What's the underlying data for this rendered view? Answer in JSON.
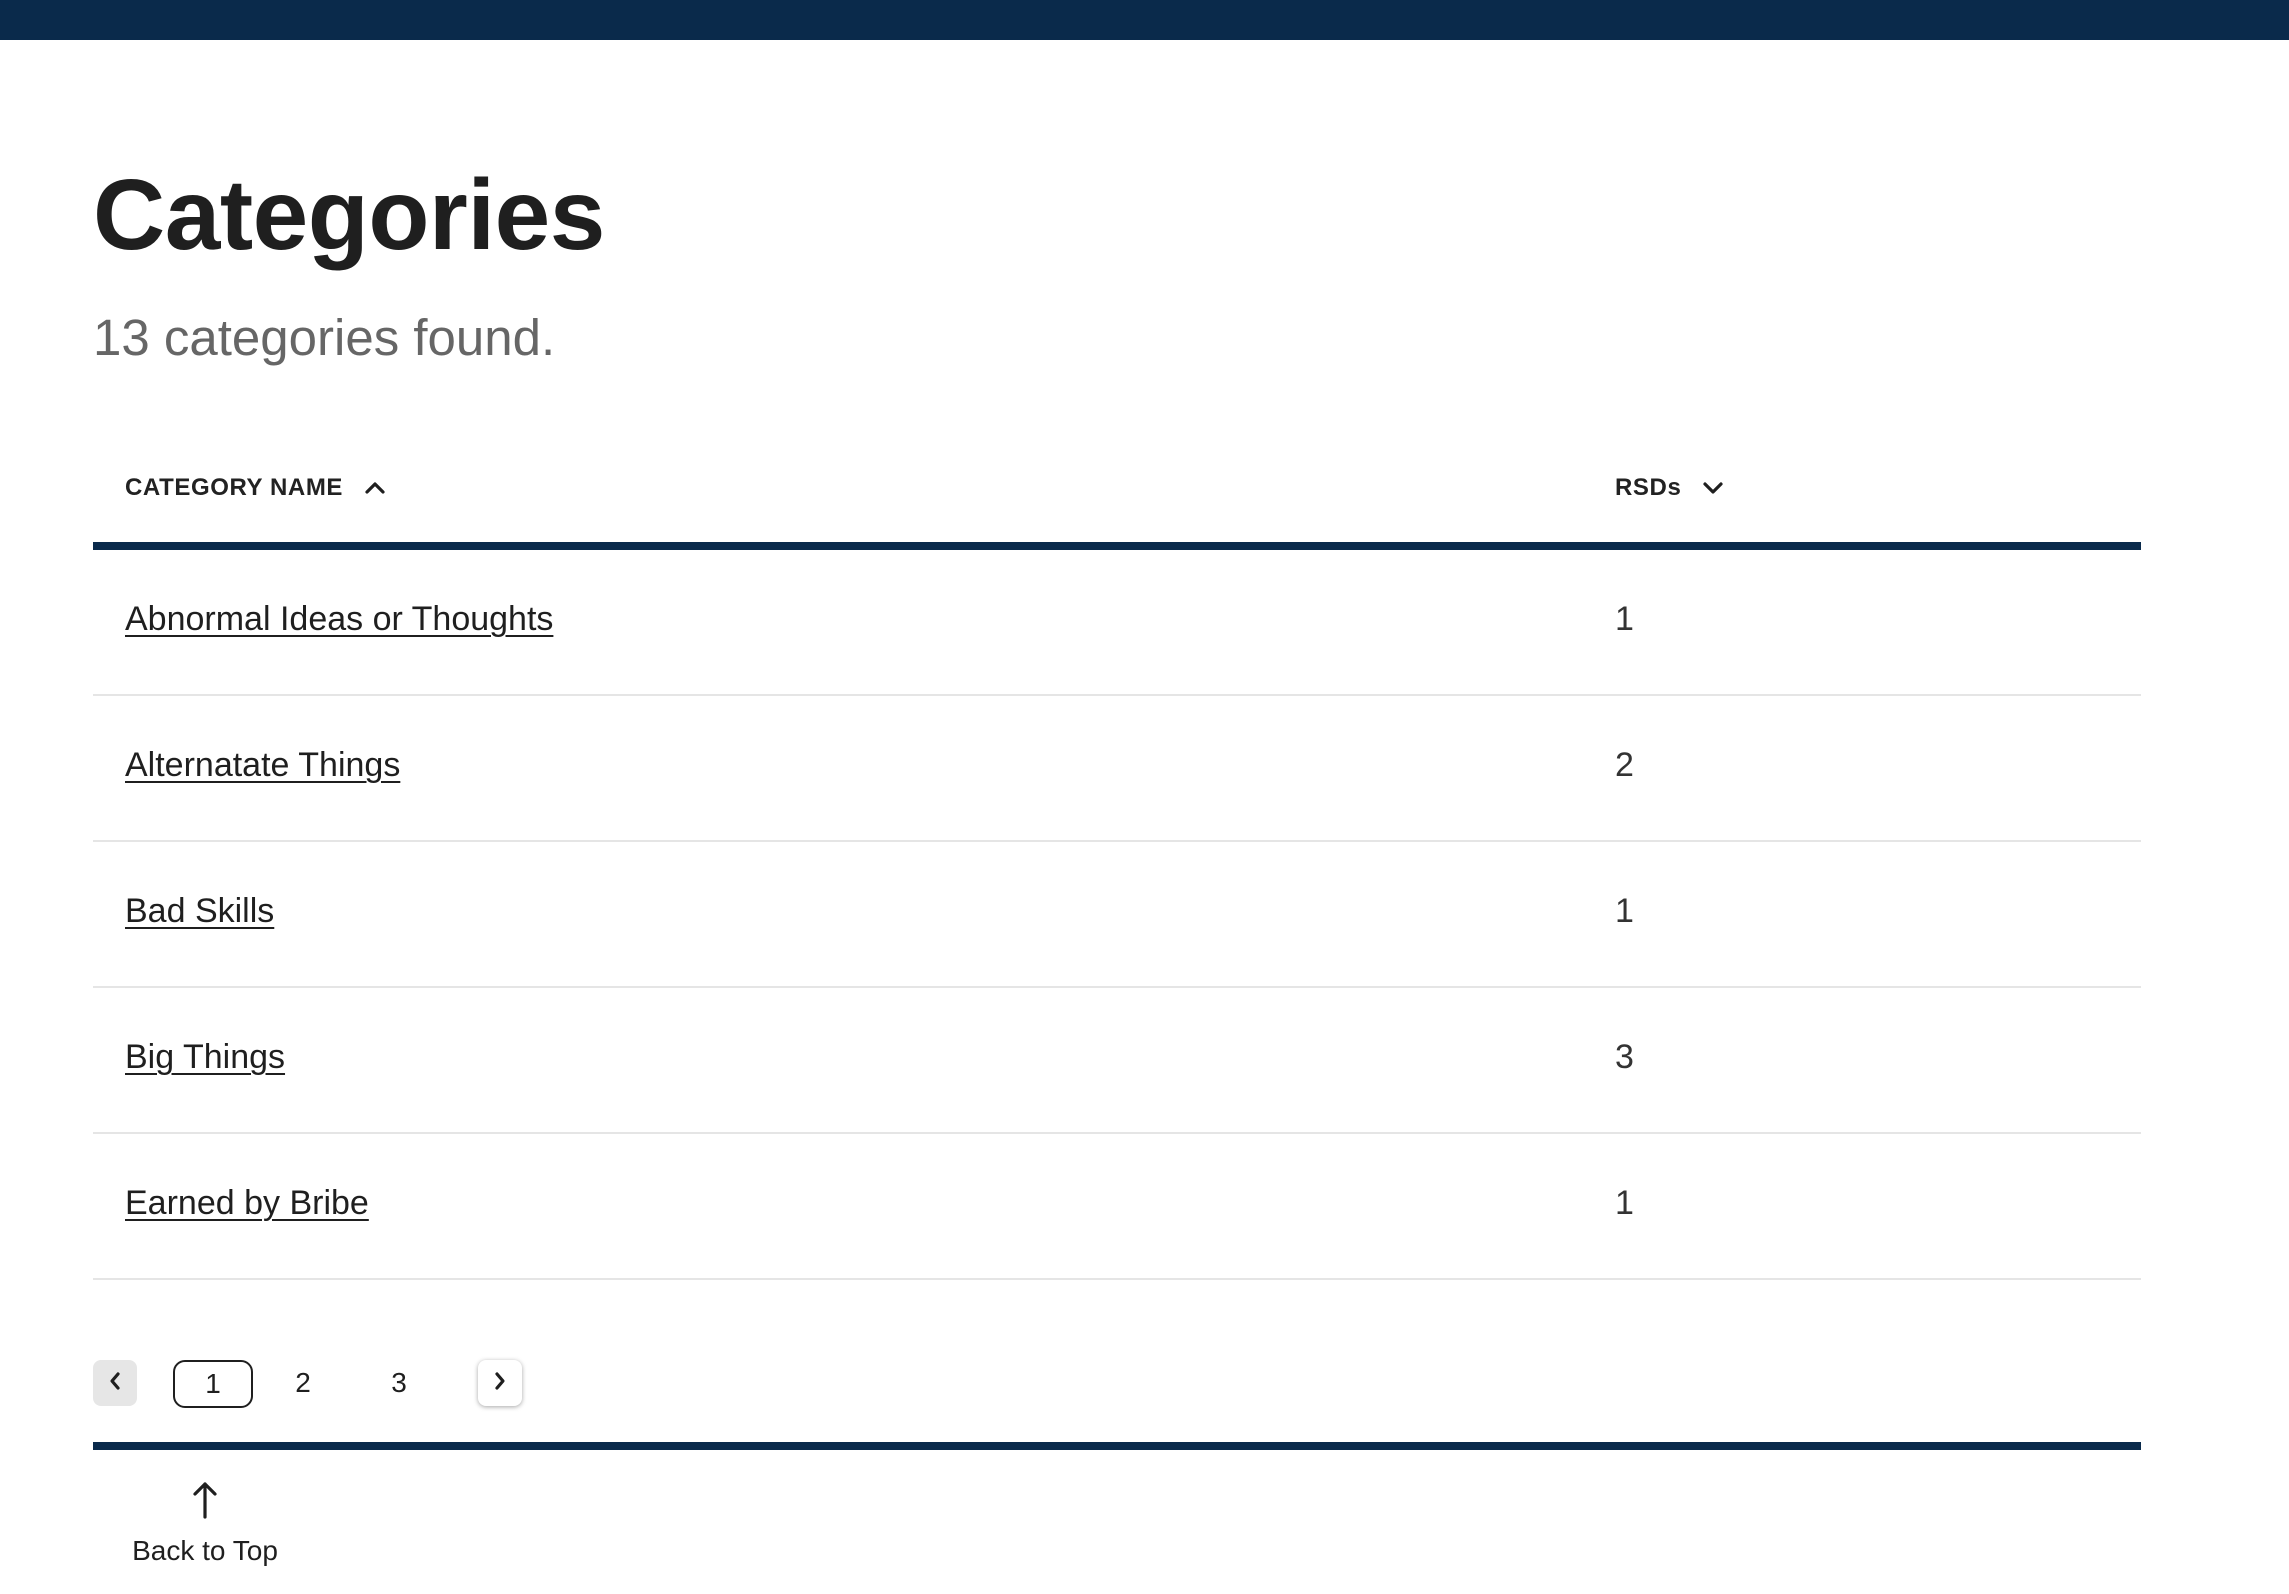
{
  "page": {
    "title": "Categories",
    "result_summary": "13 categories found."
  },
  "table": {
    "columns": [
      {
        "label": "CATEGORY NAME",
        "sort": "ascending",
        "icon": "chevron-up-icon"
      },
      {
        "label": "RSDs",
        "sort": "descending",
        "icon": "chevron-down-icon"
      }
    ],
    "rows": [
      {
        "name": "Abnormal Ideas or Thoughts",
        "rsds": "1"
      },
      {
        "name": "Alternatate Things",
        "rsds": "2"
      },
      {
        "name": "Bad Skills",
        "rsds": "1"
      },
      {
        "name": "Big Things",
        "rsds": "3"
      },
      {
        "name": "Earned by Bribe",
        "rsds": "1"
      }
    ]
  },
  "pagination": {
    "prev_icon": "chevron-left-icon",
    "next_icon": "chevron-right-icon",
    "pages": [
      "1",
      "2",
      "3"
    ],
    "current_page": "1"
  },
  "footer": {
    "back_to_top_label": "Back to Top",
    "back_to_top_icon": "arrow-up-icon"
  },
  "colors": {
    "navy": "#0a2a4b",
    "text": "#1f1f1f",
    "muted": "#666666",
    "row_divider": "#e5e5e5"
  }
}
